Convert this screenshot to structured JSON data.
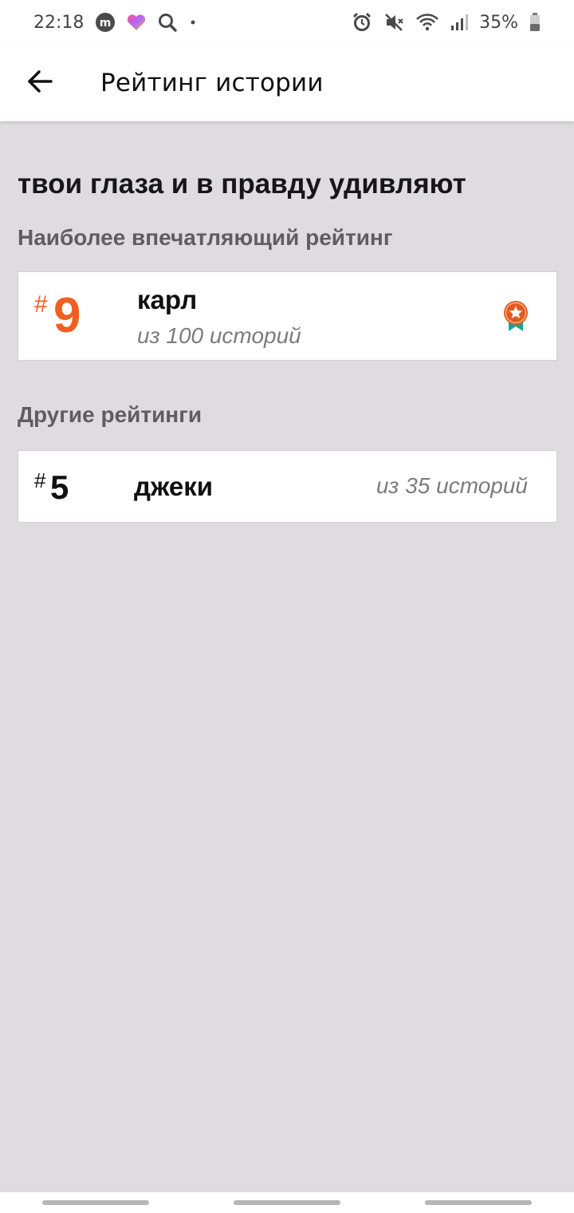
{
  "status_bar": {
    "time": "22:18",
    "battery": "35%",
    "icons_left": [
      "m-app-icon",
      "heart-app-icon",
      "search-icon",
      "dot-icon"
    ],
    "icons_right": [
      "alarm-icon",
      "mute-icon",
      "wifi-icon",
      "signal-icon",
      "battery-icon"
    ]
  },
  "app_bar": {
    "title": "Рейтинг истории",
    "back_icon": "arrow-left-icon"
  },
  "story": {
    "title": "твои глаза и в правду удивляют"
  },
  "top_ranking": {
    "section_label": "Наиболее впечатляющий рейтинг",
    "hash": "#",
    "rank": "9",
    "name": "карл",
    "subtitle": "из 100 историй",
    "accent_color": "#f15e22",
    "badge_icon": "medal-star-icon"
  },
  "other_rankings": {
    "section_label": "Другие рейтинги",
    "items": [
      {
        "hash": "#",
        "rank": "5",
        "name": "джеки",
        "subtitle": "из 35 историй"
      }
    ]
  }
}
